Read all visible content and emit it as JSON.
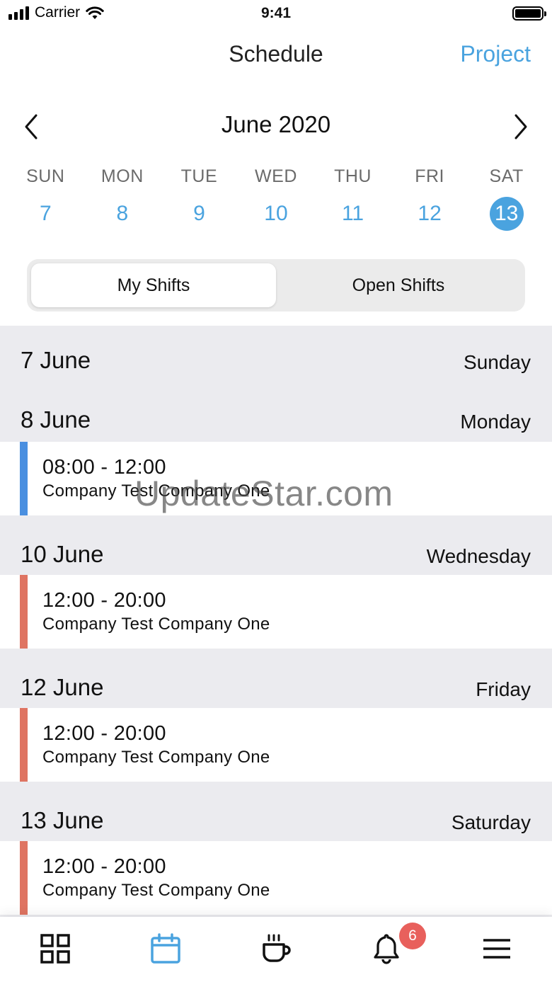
{
  "status_bar": {
    "carrier": "Carrier",
    "time": "9:41"
  },
  "nav": {
    "title": "Schedule",
    "right_action": "Project"
  },
  "calendar": {
    "month_label": "June 2020",
    "days": [
      {
        "dow": "SUN",
        "num": "7"
      },
      {
        "dow": "MON",
        "num": "8"
      },
      {
        "dow": "TUE",
        "num": "9"
      },
      {
        "dow": "WED",
        "num": "10"
      },
      {
        "dow": "THU",
        "num": "11"
      },
      {
        "dow": "FRI",
        "num": "12"
      },
      {
        "dow": "SAT",
        "num": "13",
        "selected": true
      }
    ]
  },
  "segments": {
    "my_shifts": "My Shifts",
    "open_shifts": "Open Shifts",
    "active": "my_shifts"
  },
  "sections": [
    {
      "date": "7 June",
      "weekday": "Sunday",
      "shifts": []
    },
    {
      "date": "8 June",
      "weekday": "Monday",
      "shifts": [
        {
          "time": "08:00 - 12:00",
          "company": "Company Test Company One",
          "color": "#4a8fe0"
        }
      ]
    },
    {
      "date": "10 June",
      "weekday": "Wednesday",
      "shifts": [
        {
          "time": "12:00 - 20:00",
          "company": "Company Test Company One",
          "color": "#df7462"
        }
      ]
    },
    {
      "date": "12 June",
      "weekday": "Friday",
      "shifts": [
        {
          "time": "12:00 - 20:00",
          "company": "Company Test Company One",
          "color": "#df7462"
        }
      ]
    },
    {
      "date": "13 June",
      "weekday": "Saturday",
      "shifts": [
        {
          "time": "12:00 - 20:00",
          "company": "Company Test Company One",
          "color": "#df7462"
        }
      ]
    }
  ],
  "watermark": "UpdateStar.com",
  "tab_bar": {
    "items": [
      {
        "icon": "grid-icon"
      },
      {
        "icon": "calendar-icon",
        "active": true
      },
      {
        "icon": "coffee-icon"
      },
      {
        "icon": "bell-icon",
        "badge": "6"
      },
      {
        "icon": "menu-icon"
      }
    ]
  },
  "colors": {
    "accent": "#4aa3df",
    "badge": "#e8605c",
    "list_background": "#ebebef"
  }
}
